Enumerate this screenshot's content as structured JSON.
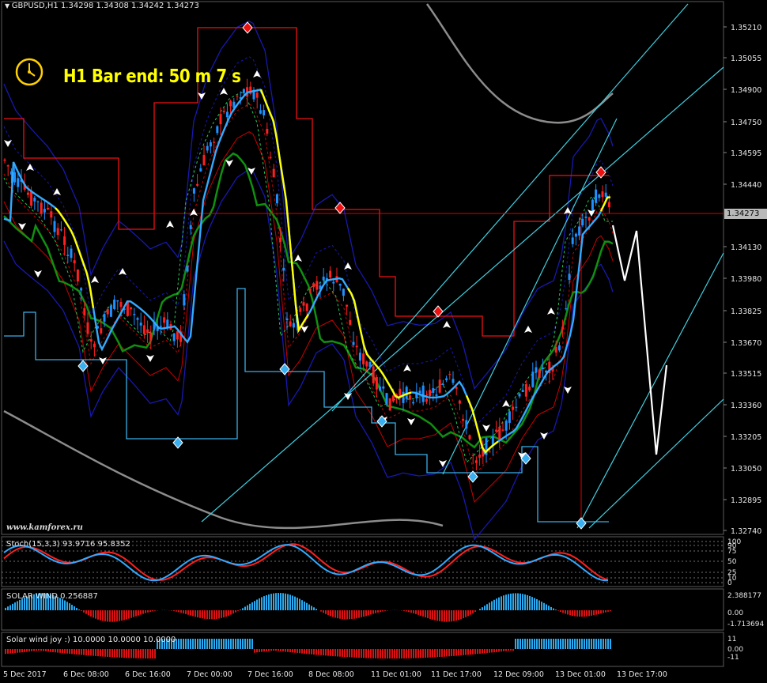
{
  "window": {
    "symbol_line": "GBPUSD,H1  1.34298 1.34308 1.34242 1.34273",
    "timer_text": "H1 Bar end: 50 m 7 s",
    "watermark": "www.kamforex.ru",
    "current_price": "1.34273",
    "icons": {
      "menu_arrow": "dropdown-triangle-icon",
      "clock": "clock-icon"
    }
  },
  "colors": {
    "background": "#000000",
    "up_candle": "#1e90ff",
    "down_candle": "#ff2020",
    "price_line": "#e00000",
    "channel_blue": "#1818b0",
    "channel_red": "#cc0000",
    "ma_green": "#109010",
    "fast_ma_yellow": "#ffff00",
    "fast_ma_blue": "#33aaff",
    "trend_cyan": "#40d0e0",
    "stoch_main": "#33aaff",
    "stoch_signal": "#ff2020",
    "timer_text": "#ffff00"
  },
  "price_axis": {
    "ticks": [
      "1.35210",
      "1.35055",
      "1.34900",
      "1.34750",
      "1.34595",
      "1.34440",
      "1.34130",
      "1.33980",
      "1.33825",
      "1.33670",
      "1.33515",
      "1.33360",
      "1.33205",
      "1.33050",
      "1.32895",
      "1.32740"
    ]
  },
  "time_axis": {
    "labels": [
      "5 Dec 2017",
      "6 Dec 08:00",
      "6 Dec 16:00",
      "7 Dec 00:00",
      "7 Dec 16:00",
      "8 Dec 08:00",
      "11 Dec 01:00",
      "11 Dec 17:00",
      "12 Dec 09:00",
      "13 Dec 01:00",
      "13 Dec 17:00"
    ]
  },
  "stoch": {
    "title": "Stoch(15,3,3) 93.9716 95.8352",
    "levels": [
      "100",
      "90",
      "75",
      "50",
      "25",
      "10",
      "0"
    ]
  },
  "solar_wind": {
    "title": "SOLAR WIND 0.256887",
    "levels": [
      "2.388177",
      "0.00",
      "-1.713694"
    ]
  },
  "solar_joy": {
    "title": "Solar wind joy :) 10.0000 10.0000 10.0000",
    "levels": [
      "11",
      "0.00",
      "-11"
    ]
  }
}
